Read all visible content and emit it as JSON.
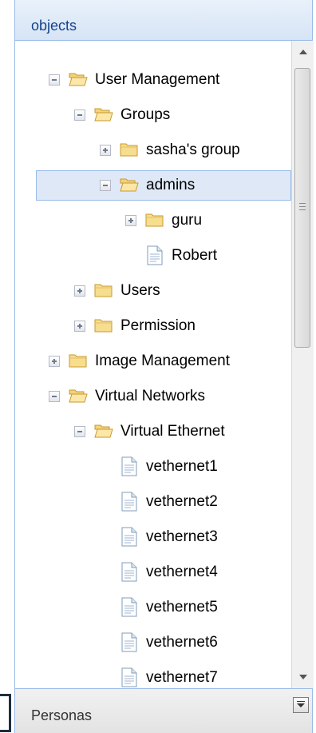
{
  "header": {
    "title": "objects"
  },
  "footer": {
    "label": "Personas"
  },
  "tree": [
    {
      "label": "User Management",
      "toggle": "minus",
      "icon": "folder-open",
      "depth": 0
    },
    {
      "label": "Groups",
      "toggle": "minus",
      "icon": "folder-open",
      "depth": 1
    },
    {
      "label": "sasha's group",
      "toggle": "plus",
      "icon": "folder-closed",
      "depth": 2
    },
    {
      "label": "admins",
      "toggle": "minus",
      "icon": "folder-open",
      "depth": 2,
      "selected": true
    },
    {
      "label": "guru",
      "toggle": "plus",
      "icon": "folder-closed",
      "depth": 3
    },
    {
      "label": "Robert",
      "toggle": "none",
      "icon": "file",
      "depth": 3
    },
    {
      "label": "Users",
      "toggle": "plus",
      "icon": "folder-closed",
      "depth": 1
    },
    {
      "label": "Permission",
      "toggle": "plus",
      "icon": "folder-closed",
      "depth": 1
    },
    {
      "label": "Image Management",
      "toggle": "plus",
      "icon": "folder-closed",
      "depth": 0
    },
    {
      "label": "Virtual Networks",
      "toggle": "minus",
      "icon": "folder-open",
      "depth": 0
    },
    {
      "label": "Virtual Ethernet",
      "toggle": "minus",
      "icon": "folder-open",
      "depth": 1
    },
    {
      "label": "vethernet1",
      "toggle": "none",
      "icon": "file",
      "depth": 2
    },
    {
      "label": "vethernet2",
      "toggle": "none",
      "icon": "file",
      "depth": 2
    },
    {
      "label": "vethernet3",
      "toggle": "none",
      "icon": "file",
      "depth": 2
    },
    {
      "label": "vethernet4",
      "toggle": "none",
      "icon": "file",
      "depth": 2
    },
    {
      "label": "vethernet5",
      "toggle": "none",
      "icon": "file",
      "depth": 2
    },
    {
      "label": "vethernet6",
      "toggle": "none",
      "icon": "file",
      "depth": 2
    },
    {
      "label": "vethernet7",
      "toggle": "none",
      "icon": "file",
      "depth": 2
    }
  ]
}
